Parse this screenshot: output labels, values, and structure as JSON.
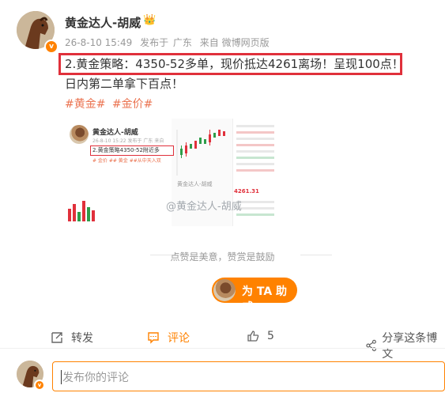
{
  "post": {
    "author": "黄金达人-胡威",
    "crown": "👑",
    "verified_mark": "v",
    "time": "26-8-10 15:49",
    "posted_from_label": "发布于",
    "location": "广东",
    "source": "来自 微博网页版",
    "highlight_line": "2.黄金策略：4350-52多单，现价抵达4261离场！呈现100点！",
    "second_line": "日内第二单拿下百点！",
    "tags": [
      "#黄金#",
      "#金价#"
    ]
  },
  "image": {
    "mini_name": "黄金达人-胡威",
    "mini_meta": "26-8-10 15:22 发布于 广东 来自",
    "mini_text": "2.黄金策略4350-52附近多",
    "mini_tags": "# 金价 ## 黄金 ##从中天入双",
    "mini_tail": "黄金达人-胡威",
    "watermark": "@黄金达人-胡威",
    "price": "4261.31"
  },
  "like_prompt": "点赞是美意，赞赏是鼓励",
  "reward_button": "为 TA 助威",
  "actions": {
    "repost": "转发",
    "comment": "评论",
    "like_count": "5",
    "share": "分享这条博文"
  },
  "comment_box": {
    "placeholder": "发布你的评论"
  },
  "colors": {
    "accent": "#ff8200",
    "highlight_border": "#e0303b",
    "tag": "#eb7350"
  }
}
